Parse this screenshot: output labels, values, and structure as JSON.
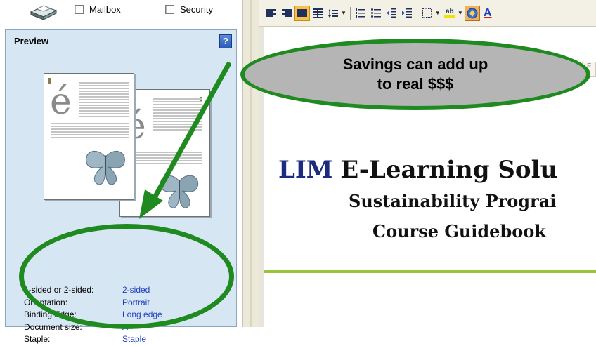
{
  "delivery_options": {
    "mailbox_label": "Mailbox",
    "mailbox_checked": false,
    "security_label": "Security",
    "security_checked": false
  },
  "preview": {
    "title": "Preview",
    "help_label": "?",
    "page_glyph": "é",
    "properties": [
      {
        "label": "1-sided or 2-sided:",
        "value": "2-sided"
      },
      {
        "label": "Orientation:",
        "value": "Portrait"
      },
      {
        "label": "Binding Edge:",
        "value": "Long edge"
      },
      {
        "label": "Document size:",
        "value": "A4"
      },
      {
        "label": "Staple:",
        "value": "Staple"
      }
    ]
  },
  "toolbar": {
    "icons": [
      "align-left-icon",
      "align-right-icon",
      "justify-icon",
      "distributed-icon",
      "line-spacing-icon",
      "numbered-list-icon",
      "bulleted-list-icon",
      "decrease-indent-icon",
      "increase-indent-icon",
      "borders-icon",
      "highlight-icon",
      "clip-art-icon",
      "font-color-icon"
    ],
    "highlight_label": "ab",
    "font_color_label": "A"
  },
  "document": {
    "title_brand": "LIM",
    "title_rest": "E-Learning Solu",
    "subtitle_1": "Sustainability Prograi",
    "subtitle_2": "Course Guidebook",
    "ruler_marker": "F"
  },
  "callout": {
    "text_line1": "Savings can add up",
    "text_line2": "to real $$$"
  },
  "colors": {
    "annotation_green": "#1f8a1f",
    "bubble_gray": "#b5b5b5",
    "preview_bg": "#d6e6f2",
    "value_blue": "#1f3fbf",
    "brand_navy": "#1c2a80",
    "rule_green": "#9ac43a"
  }
}
